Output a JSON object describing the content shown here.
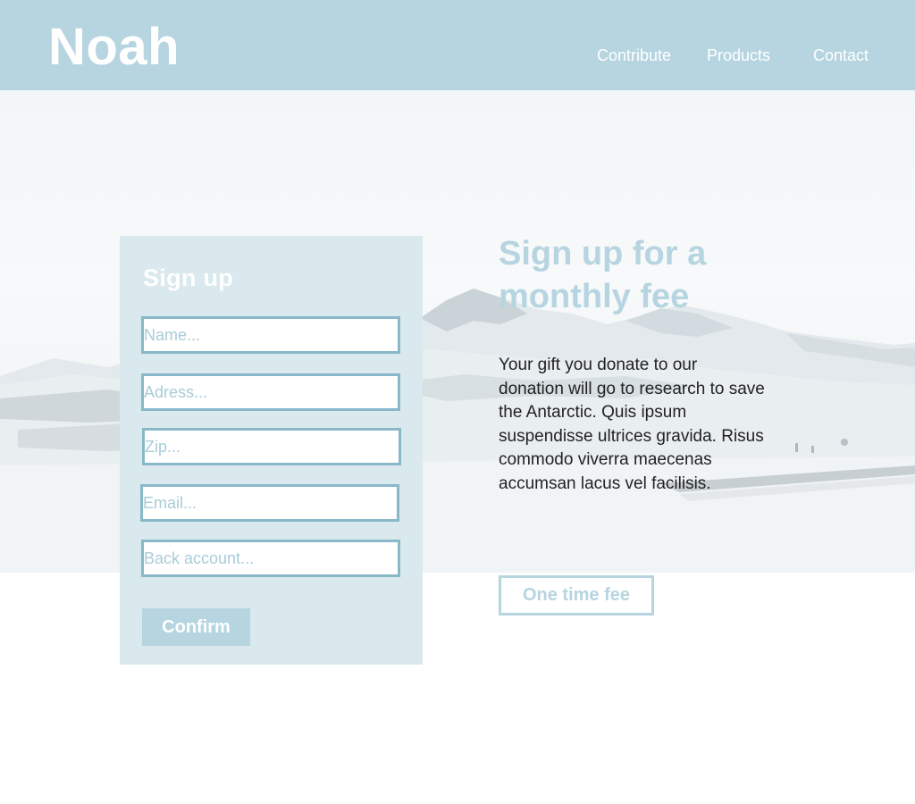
{
  "header": {
    "logo": "Noah",
    "nav": [
      "Contribute",
      "Products",
      "Contact"
    ]
  },
  "signup": {
    "title": "Sign up",
    "fields": {
      "name": "Name...",
      "address": "Adress...",
      "zip": "Zip...",
      "email": "Email...",
      "bank": "Back account..."
    },
    "confirm_label": "Confirm"
  },
  "hero": {
    "heading": "Sign up for a monthly fee",
    "text": "Your gift you donate to our donation will go to research to save the Antarctic. Quis ipsum suspendisse ultrices gravida. Risus commodo viverra maecenas accumsan lacus vel facilisis.",
    "one_time_label": "One time fee",
    "background": "snowy-antarctic-landscape"
  },
  "colors": {
    "accent": "#b6d5e0",
    "panel": "#d9e9ed",
    "field_border": "#89b8c9",
    "text": "#222222"
  }
}
